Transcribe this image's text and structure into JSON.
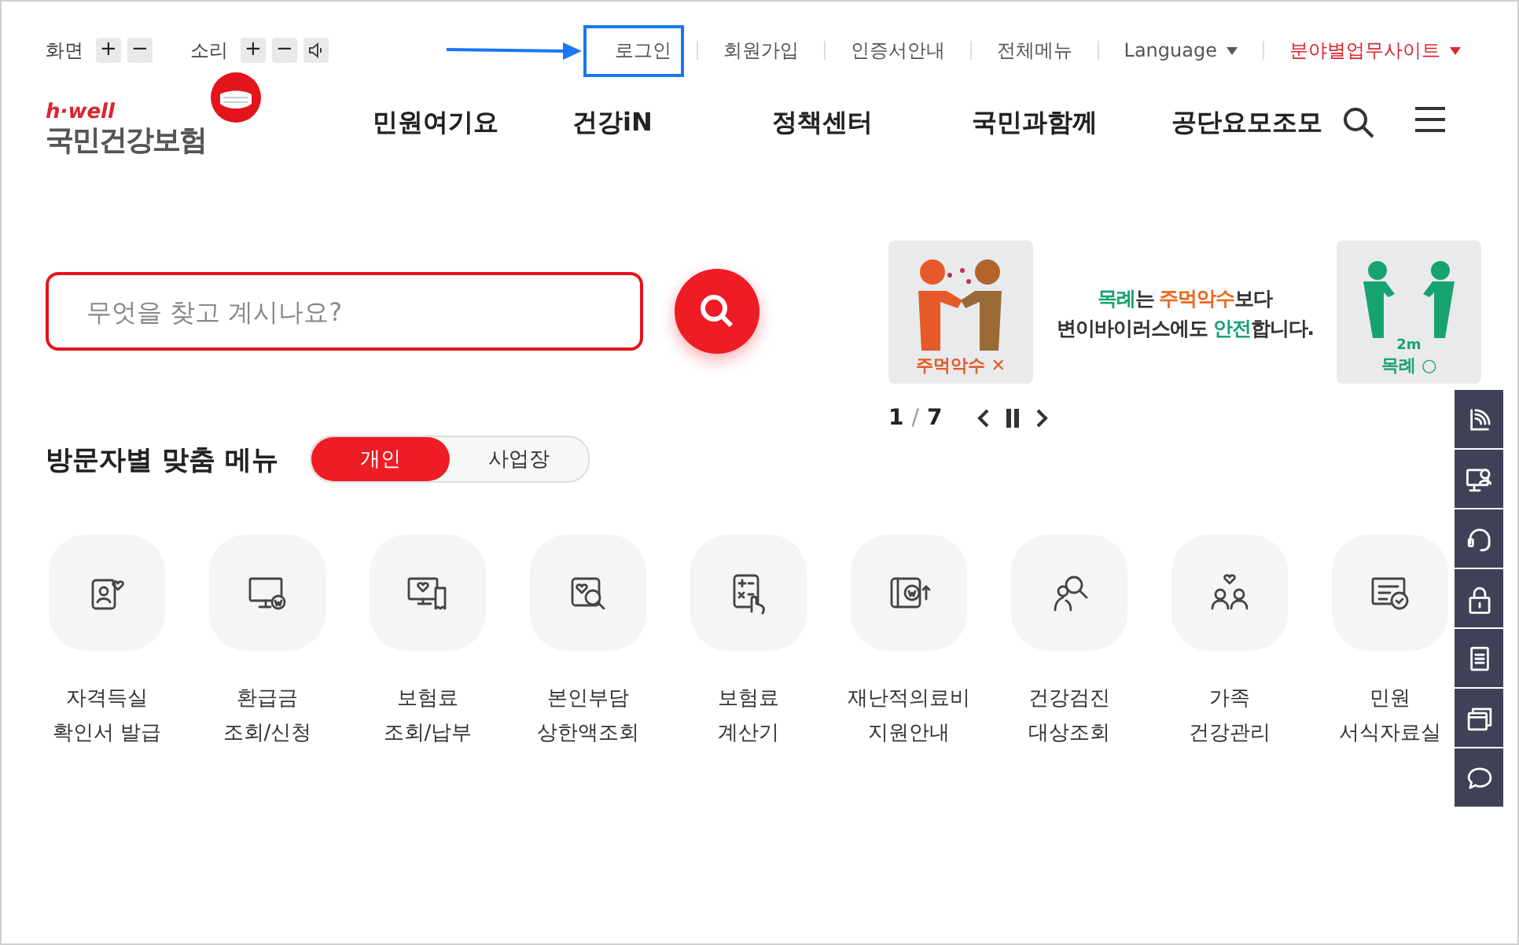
{
  "top_bar": {
    "screen_label": "화면",
    "sound_label": "소리",
    "zoom_in": "+",
    "zoom_out": "−",
    "volume_up": "+",
    "volume_down": "−",
    "links": [
      {
        "label": "로그인",
        "highlighted": true,
        "kind": "link"
      },
      {
        "label": "회원가입",
        "highlighted": false,
        "kind": "link"
      },
      {
        "label": "인증서안내",
        "highlighted": false,
        "kind": "link"
      },
      {
        "label": "전체메뉴",
        "highlighted": false,
        "kind": "link"
      },
      {
        "label": "Language",
        "highlighted": false,
        "kind": "dropdown"
      },
      {
        "label": "분야별업무사이트",
        "highlighted": false,
        "kind": "dropdown-accent"
      }
    ]
  },
  "logo": {
    "tagline": "h·well",
    "name": "국민건강보험"
  },
  "nav": [
    "민원여기요",
    "건강iN",
    "정책센터",
    "국민과함께",
    "공단요모조모"
  ],
  "search": {
    "placeholder": "무엇을 찾고 계시나요?"
  },
  "banner": {
    "left_label": "주먹악수 ✕",
    "message": [
      [
        {
          "text": "목례",
          "color": "#17a36f"
        },
        {
          "text": "는 ",
          "color": "#333333"
        },
        {
          "text": "주먹악수",
          "color": "#ea6a1e"
        },
        {
          "text": "보다",
          "color": "#333333"
        }
      ],
      [
        {
          "text": "변이바이러스에도 ",
          "color": "#333333"
        },
        {
          "text": "안전",
          "color": "#17a36f"
        },
        {
          "text": "합니다.",
          "color": "#333333"
        }
      ]
    ],
    "distance": "2m",
    "right_label": "목례 ○",
    "current": "1",
    "separator": "/",
    "total": "7"
  },
  "visitor_menu": {
    "title": "방문자별 맞춤 메뉴",
    "tabs": [
      {
        "label": "개인",
        "selected": true
      },
      {
        "label": "사업장",
        "selected": false
      }
    ],
    "items": [
      {
        "lines": [
          "자격득실",
          "확인서 발급"
        ]
      },
      {
        "lines": [
          "환급금",
          "조회/신청"
        ]
      },
      {
        "lines": [
          "보험료",
          "조회/납부"
        ]
      },
      {
        "lines": [
          "본인부담",
          "상한액조회"
        ]
      },
      {
        "lines": [
          "보험료",
          "계산기"
        ]
      },
      {
        "lines": [
          "재난적의료비",
          "지원안내"
        ]
      },
      {
        "lines": [
          "건강검진",
          "대상조회"
        ]
      },
      {
        "lines": [
          "가족",
          "건강관리"
        ]
      },
      {
        "lines": [
          "민원",
          "서식자료실"
        ]
      }
    ]
  }
}
